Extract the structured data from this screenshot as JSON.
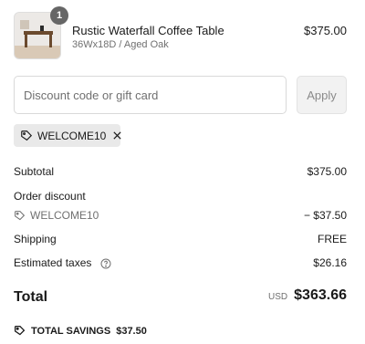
{
  "line_item": {
    "quantity": "1",
    "name": "Rustic Waterfall Coffee Table",
    "variant": "36Wx18D / Aged Oak",
    "price": "$375.00",
    "image_icon": "coffee-table-product-photo"
  },
  "discount": {
    "placeholder": "Discount code or gift card",
    "value": "",
    "apply_label": "Apply",
    "applied_code": "WELCOME10"
  },
  "summary": {
    "subtotal_label": "Subtotal",
    "subtotal_value": "$375.00",
    "order_discount_label": "Order discount",
    "discount_code": "WELCOME10",
    "discount_value": "− $37.50",
    "shipping_label": "Shipping",
    "shipping_value": "FREE",
    "taxes_label": "Estimated taxes",
    "taxes_value": "$26.16"
  },
  "total": {
    "label": "Total",
    "currency": "USD",
    "amount": "$363.66"
  },
  "savings": {
    "label": "TOTAL SAVINGS",
    "amount": "$37.50"
  },
  "colors": {
    "text": "#1a1a1a",
    "muted": "#707070",
    "badge": "#666666",
    "tag_bg": "#e9e9e9",
    "button_bg": "#f2f2f2"
  }
}
